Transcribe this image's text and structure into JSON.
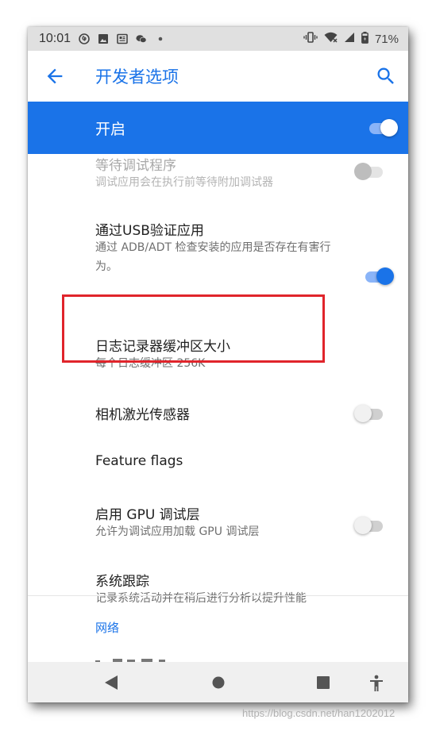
{
  "status_bar": {
    "time": "10:01",
    "battery_percent": "71%",
    "left_icons": [
      "netease-music-icon",
      "image-icon",
      "news-icon",
      "wechat-icon",
      "more-dot-icon"
    ],
    "right_icons": [
      "vibrate-icon",
      "wifi-icon",
      "signal-icon",
      "battery-icon"
    ]
  },
  "app_bar": {
    "title": "开发者选项",
    "back_icon": "arrow-back-icon",
    "search_icon": "search-icon"
  },
  "master_switch": {
    "label": "开启",
    "checked": true
  },
  "settings": [
    {
      "title": "等待调试程序",
      "summary": "调试应用会在执行前等待附加调试器",
      "toggle": "disabled",
      "faded": true
    },
    {
      "title": "通过USB验证应用",
      "summary": "通过 ADB/ADT 检查安装的应用是否存在有害行为。",
      "toggle": "on"
    },
    {
      "title": "日志记录器缓冲区大小",
      "summary": "每个日志缓冲区 256K",
      "toggle": null
    },
    {
      "title": "相机激光传感器",
      "summary": "",
      "toggle": "off"
    },
    {
      "title": "Feature flags",
      "summary": "",
      "toggle": null
    },
    {
      "title": "启用 GPU 调试层",
      "summary": "允许为调试应用加载 GPU 调试层",
      "toggle": "off"
    },
    {
      "title": "系统跟踪",
      "summary": "记录系统活动并在稍后进行分析以提升性能",
      "toggle": null
    }
  ],
  "category": {
    "label": "网络"
  },
  "nav_bar": {
    "buttons": [
      "back-triangle-icon",
      "home-circle-icon",
      "recents-square-icon",
      "accessibility-icon"
    ]
  },
  "colors": {
    "accent": "#1a73e8",
    "highlight_border": "#e0242b",
    "status_bar_bg": "#e0e0e0",
    "nav_bar_bg": "#f0f0f0"
  },
  "watermark": "https://blog.csdn.net/han1202012"
}
